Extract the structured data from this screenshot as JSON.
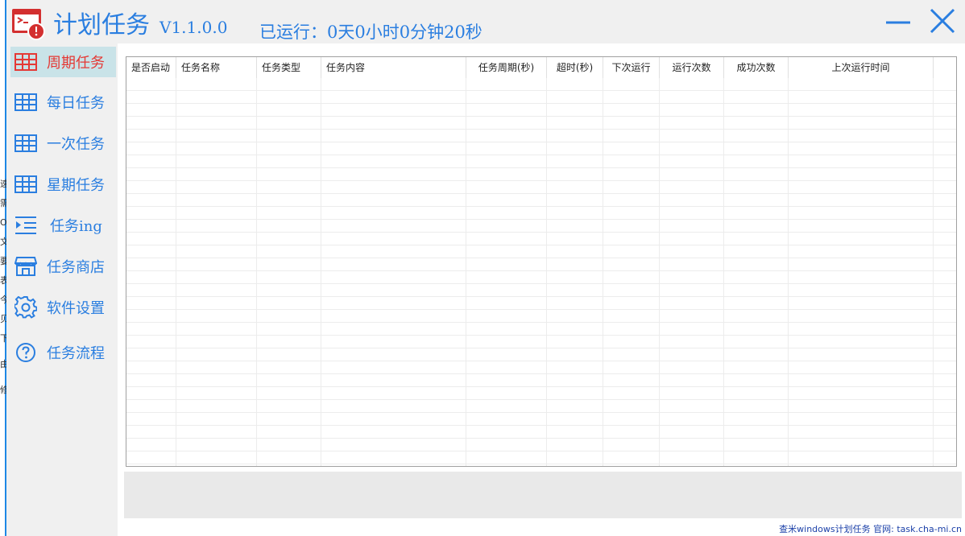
{
  "window": {
    "title": "计划任务",
    "version": "V1.1.0.0",
    "runtime": "已运行：0天0小时0分钟20秒"
  },
  "colors": {
    "accent": "#2a7ee0",
    "active_text": "#e53935",
    "active_bg": "#c9e3e8"
  },
  "left_edge_chars": [
    "速",
    "需",
    "O",
    "文",
    "要",
    "表",
    "今",
    "贝",
    "下",
    "由",
    "修"
  ],
  "sidebar": {
    "items": [
      {
        "label": "周期任务",
        "icon": "table-grid-icon",
        "active": true
      },
      {
        "label": "每日任务",
        "icon": "table-grid-icon",
        "active": false
      },
      {
        "label": "一次任务",
        "icon": "table-grid-icon",
        "active": false
      },
      {
        "label": "星期任务",
        "icon": "table-grid-icon",
        "active": false
      },
      {
        "label": "任务ing",
        "icon": "list-indent-icon",
        "active": false
      },
      {
        "label": "任务商店",
        "icon": "store-icon",
        "active": false
      },
      {
        "label": "软件设置",
        "icon": "gear-icon",
        "active": false
      },
      {
        "label": "任务流程",
        "icon": "help-circle-icon",
        "active": false
      }
    ]
  },
  "table": {
    "columns": [
      "是否启动",
      "任务名称",
      "任务类型",
      "任务内容",
      "任务周期(秒)",
      "超时(秒)",
      "下次运行",
      "运行次数",
      "成功次数",
      "上次运行时间"
    ],
    "rows": []
  },
  "footer": {
    "text": "查米windows计划任务 官网: task.cha-mi.cn"
  }
}
